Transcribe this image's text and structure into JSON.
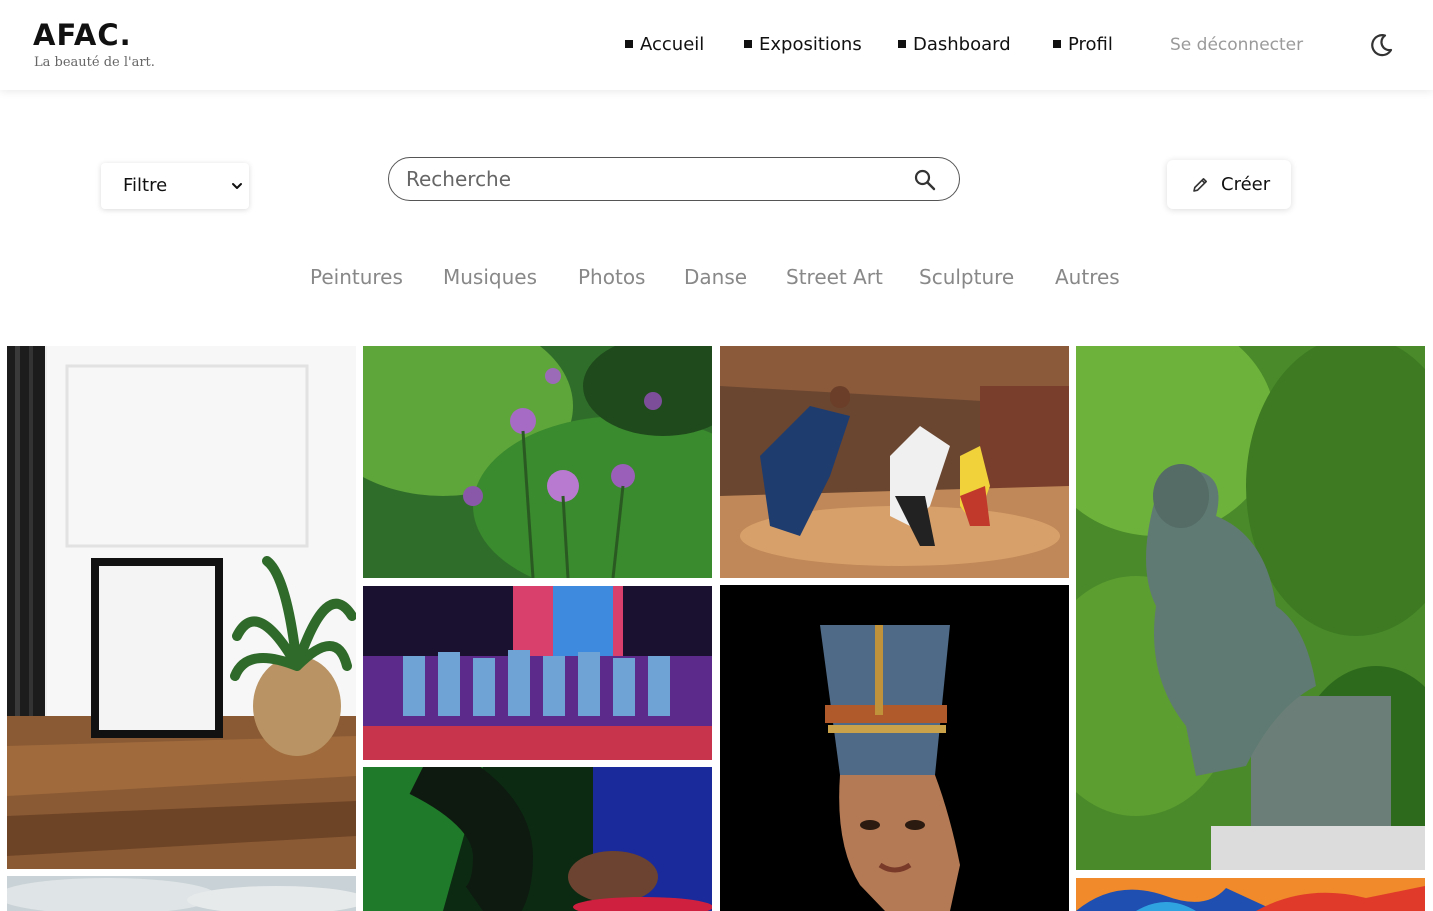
{
  "brand": {
    "name": "AFAC.",
    "tagline": "La beauté de l'art."
  },
  "nav": {
    "items": [
      {
        "label": "Accueil"
      },
      {
        "label": "Expositions"
      },
      {
        "label": "Dashboard"
      },
      {
        "label": "Profil"
      }
    ],
    "logout_label": "Se déconnecter",
    "theme_icon": "moon-icon"
  },
  "toolbar": {
    "filter": {
      "selected": "Filtre",
      "icon": "chevron-down-icon"
    },
    "search": {
      "placeholder": "Recherche",
      "value": "",
      "icon": "search-icon"
    },
    "create": {
      "label": "Créer",
      "icon": "pencil-icon"
    }
  },
  "categories": [
    "Peintures",
    "Musiques",
    "Photos",
    "Danse",
    "Street Art",
    "Sculpture",
    "Autres"
  ],
  "colors": {
    "text": "#111111",
    "muted": "#888888",
    "logout": "#9a9a9a",
    "background": "#ffffff"
  },
  "gallery": {
    "items": [
      {
        "name": "artwork-frame-plant-image"
      },
      {
        "name": "artwork-purple-flowers-image"
      },
      {
        "name": "artwork-dancers-studio-image"
      },
      {
        "name": "artwork-thinker-sculpture-image"
      },
      {
        "name": "artwork-dance-crew-stage-image"
      },
      {
        "name": "artwork-nefertiti-bust-image"
      },
      {
        "name": "artwork-dj-turntable-image"
      },
      {
        "name": "artwork-sky-image"
      },
      {
        "name": "artwork-colorful-painting-image"
      }
    ]
  }
}
